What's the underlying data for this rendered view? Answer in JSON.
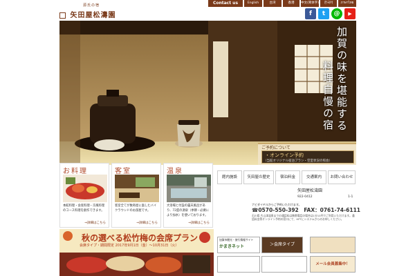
{
  "header": {
    "logo_small": "源氏の宿",
    "logo_name": "矢田屋松濤園",
    "contact_label": "Contact us",
    "languages": [
      "English",
      "台湾",
      "香港",
      "中文(简体字)",
      "한국어",
      "ภาษาไทย"
    ],
    "sns": [
      {
        "icon": "facebook-icon",
        "glyph": "f",
        "color": "#3b5998"
      },
      {
        "icon": "twitter-icon",
        "glyph": "t",
        "color": "#1da1f2"
      },
      {
        "icon": "line-icon",
        "glyph": "@",
        "color": "#00b900"
      },
      {
        "icon": "youtube-icon",
        "glyph": "▶",
        "color": "#e62117"
      }
    ]
  },
  "hero": {
    "tagline_1": "加賀の味を堪能する",
    "tagline_2": "料理自慢の宿"
  },
  "reservation": {
    "title": "ご予約について",
    "online_label": "・オンライン予約",
    "online_sub": "（当館オリジナル宿泊プラン・空室状況の照会）"
  },
  "cards": [
    {
      "title": "お料理",
      "text": "本館料理・会席料理・京風料理のコース料理を創作できます。",
      "more": "⇒詳細はこちら"
    },
    {
      "title": "客室",
      "text": "客室全てが数奇屋に面したバイクラウンドのお部屋です。",
      "more": "⇒詳細はこちら"
    },
    {
      "title": "温泉",
      "text": "大浴場と付設の露天風呂があり、72度の源泉（季節・必要により加水）を使いております。",
      "more": "⇒詳細はこちら"
    }
  ],
  "nav": [
    "館内施設",
    "矢田屋の歴史",
    "宿泊料金",
    "交通案内",
    "お問い合わせ"
  ],
  "address": {
    "name": "矢田屋松濤園",
    "postal": "922-0412",
    "number": "1-1",
    "tel_note": "ナビダイヤルからご予約いただけます。",
    "tel": "☎0570-550-392　FAX：0761-74-6111",
    "tel_sub": "石川県 片山津温泉までの通話料は携帯電話の場合は1分10円でご利用いただけます。通話料金等オンライン予約の窓口にて、HPTにシステムからのお申しください。"
  },
  "banner": {
    "title": "秋の選べる松竹梅の会席プラン",
    "sub": "会席タイプ・期間限定 2017年9月1日（金）～10月31日（火）",
    "type_label": "会席タイプ"
  },
  "side": {
    "portal_note": "加賀市観光・旅行情報サイト",
    "portal_name": "かまきネット",
    "plan_label": "＞会席タイプ",
    "mail_label": "メール会員募集中！"
  },
  "colors": {
    "brand": "#7a3a1a",
    "accent": "#b04a2a"
  }
}
